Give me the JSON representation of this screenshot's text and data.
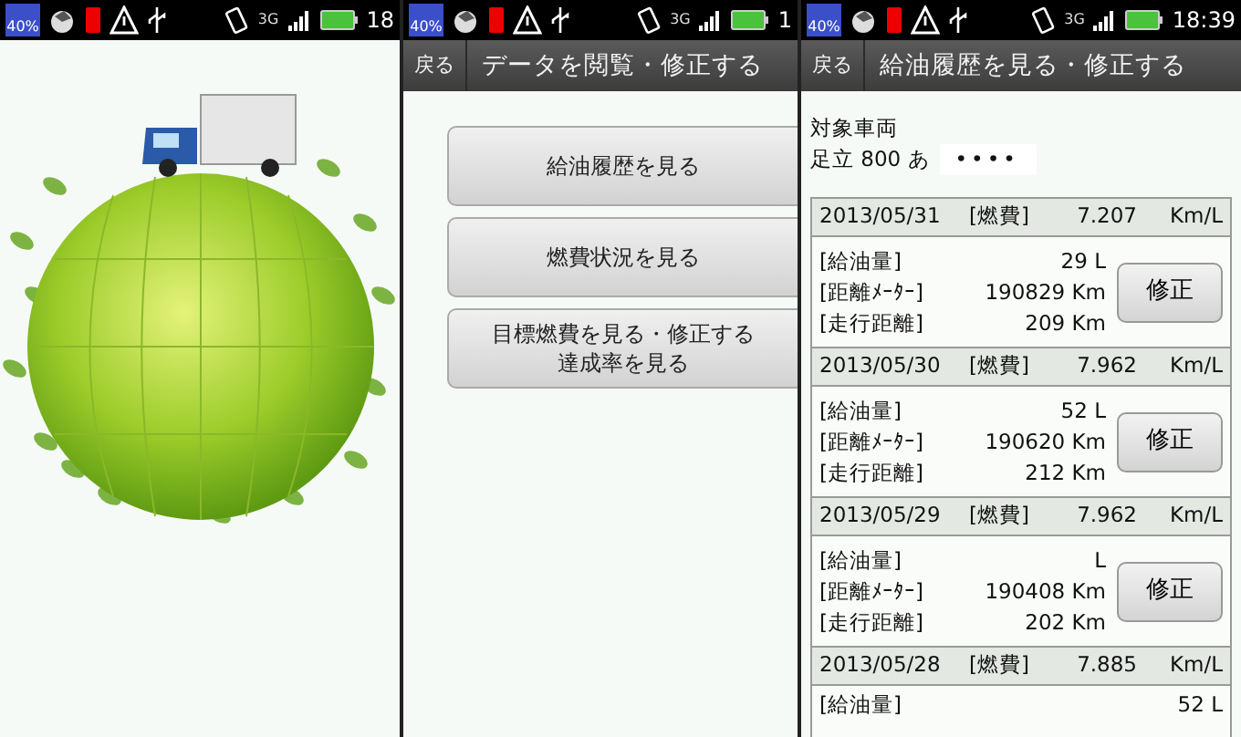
{
  "screens": [
    {
      "kind": "splash",
      "status_bar": {
        "battery_text": "40%",
        "network": "3G",
        "time": "18"
      }
    },
    {
      "kind": "menu",
      "status_bar": {
        "battery_text": "40%",
        "network": "3G",
        "time": "1"
      },
      "back_button": "戻る",
      "title": "データを閲覧・修正する",
      "menu_buttons": [
        {
          "lines": [
            "給油履歴を見る"
          ]
        },
        {
          "lines": [
            "燃費状況を見る"
          ]
        },
        {
          "lines": [
            "目標燃費を見る・修正する",
            "達成率を見る"
          ]
        }
      ]
    },
    {
      "kind": "history",
      "status_bar": {
        "battery_text": "40%",
        "network": "3G",
        "time": "18:39"
      },
      "back_button": "戻る",
      "title": "給油履歴を見る・修正する",
      "vehicle_label": "対象車両",
      "plate_prefix": "足立 800 あ",
      "plate_number": "••••",
      "records": [
        {
          "date": "2013/05/31",
          "economy_label": "[燃費]",
          "economy": "7.207",
          "economy_unit": "Km/L",
          "rows": [
            {
              "label": "[給油量]",
              "value": "29 L"
            },
            {
              "label": "[距離ﾒｰﾀｰ]",
              "value": "190829 Km"
            },
            {
              "label": "[走行距離]",
              "value": "209 Km"
            }
          ],
          "edit_button": "修正"
        },
        {
          "date": "2013/05/30",
          "economy_label": "[燃費]",
          "economy": "7.962",
          "economy_unit": "Km/L",
          "rows": [
            {
              "label": "[給油量]",
              "value": "52 L"
            },
            {
              "label": "[距離ﾒｰﾀｰ]",
              "value": "190620 Km"
            },
            {
              "label": "[走行距離]",
              "value": "212 Km"
            }
          ],
          "edit_button": "修正"
        },
        {
          "date": "2013/05/29",
          "economy_label": "[燃費]",
          "economy": "7.962",
          "economy_unit": "Km/L",
          "rows": [
            {
              "label": "[給油量]",
              "value": "L"
            },
            {
              "label": "[距離ﾒｰﾀｰ]",
              "value": "190408 Km"
            },
            {
              "label": "[走行距離]",
              "value": "202 Km"
            }
          ],
          "edit_button": "修正"
        },
        {
          "date": "2013/05/28",
          "economy_label": "[燃費]",
          "economy": "7.885",
          "economy_unit": "Km/L",
          "rows": [
            {
              "label": "[給油量]",
              "value": "52 L"
            }
          ]
        }
      ]
    }
  ]
}
